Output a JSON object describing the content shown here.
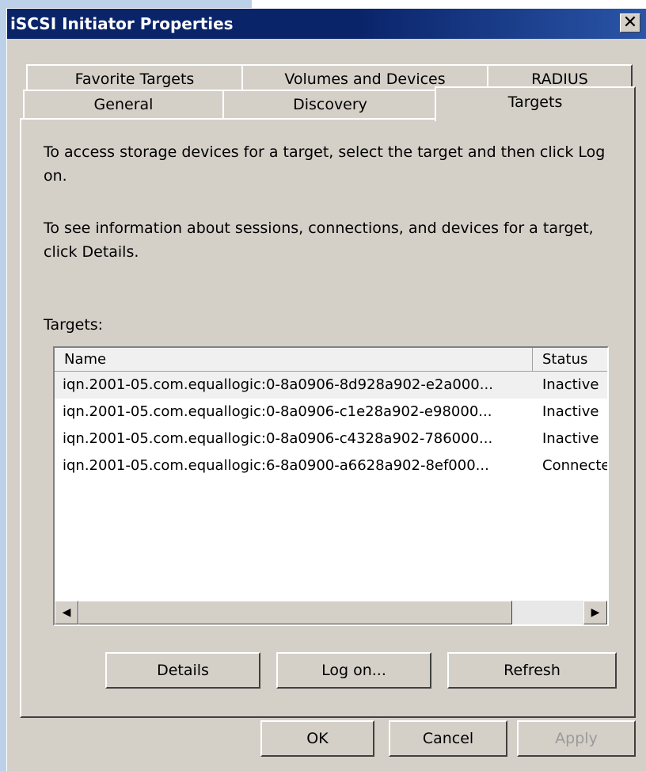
{
  "window": {
    "title": "iSCSI Initiator Properties",
    "close_glyph": "✕"
  },
  "tabs": {
    "row_back": [
      "Favorite Targets",
      "Volumes and Devices",
      "RADIUS"
    ],
    "row_front": [
      "General",
      "Discovery",
      "Targets"
    ],
    "active": "Targets"
  },
  "panel": {
    "desc1": "To access storage devices for a target, select the target and then click Log on.",
    "desc2": "To see information about sessions, connections, and devices for a target, click Details.",
    "targets_label": "Targets:"
  },
  "table": {
    "columns": [
      "Name",
      "Status"
    ],
    "rows": [
      {
        "name": "iqn.2001-05.com.equallogic:0-8a0906-8d928a902-e2a000...",
        "status": "Inactive"
      },
      {
        "name": "iqn.2001-05.com.equallogic:0-8a0906-c1e28a902-e98000...",
        "status": "Inactive"
      },
      {
        "name": "iqn.2001-05.com.equallogic:0-8a0906-c4328a902-786000...",
        "status": "Inactive"
      },
      {
        "name": "iqn.2001-05.com.equallogic:6-8a0900-a6628a902-8ef000...",
        "status": "Connecte"
      }
    ]
  },
  "panel_buttons": {
    "details": "Details",
    "logon": "Log on...",
    "refresh": "Refresh"
  },
  "dialog_buttons": {
    "ok": "OK",
    "cancel": "Cancel",
    "apply": "Apply"
  }
}
